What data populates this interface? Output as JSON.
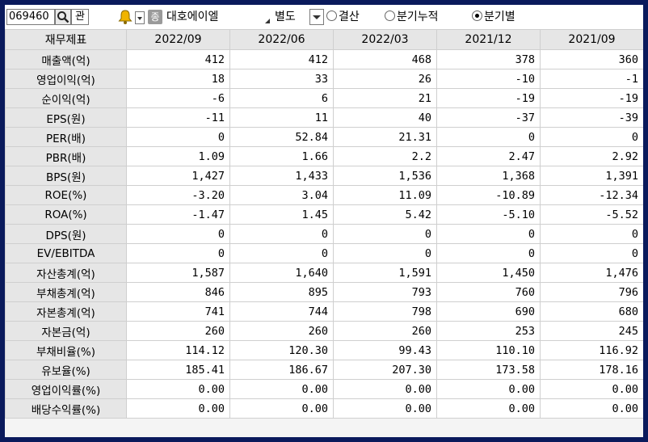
{
  "toolbar": {
    "code": "069460",
    "dropdown_label": "관",
    "name_icon": "종",
    "company_name": "대호에이엘",
    "select_value": "별도",
    "radios": [
      {
        "label": "결산",
        "selected": false
      },
      {
        "label": "분기누적",
        "selected": false
      },
      {
        "label": "분기별",
        "selected": true
      }
    ]
  },
  "table": {
    "corner_label": "재무제표",
    "columns": [
      "2022/09",
      "2022/06",
      "2022/03",
      "2021/12",
      "2021/09"
    ],
    "rows": [
      {
        "label": "매출액(억)",
        "values": [
          "412",
          "412",
          "468",
          "378",
          "360"
        ]
      },
      {
        "label": "영업이익(억)",
        "values": [
          "18",
          "33",
          "26",
          "-10",
          "-1"
        ]
      },
      {
        "label": "순이익(억)",
        "values": [
          "-6",
          "6",
          "21",
          "-19",
          "-19"
        ]
      },
      {
        "label": "EPS(원)",
        "values": [
          "-11",
          "11",
          "40",
          "-37",
          "-39"
        ]
      },
      {
        "label": "PER(배)",
        "values": [
          "0",
          "52.84",
          "21.31",
          "0",
          "0"
        ]
      },
      {
        "label": "PBR(배)",
        "values": [
          "1.09",
          "1.66",
          "2.2",
          "2.47",
          "2.92"
        ]
      },
      {
        "label": "BPS(원)",
        "values": [
          "1,427",
          "1,433",
          "1,536",
          "1,368",
          "1,391"
        ]
      },
      {
        "label": "ROE(%)",
        "values": [
          "-3.20",
          "3.04",
          "11.09",
          "-10.89",
          "-12.34"
        ]
      },
      {
        "label": "ROA(%)",
        "values": [
          "-1.47",
          "1.45",
          "5.42",
          "-5.10",
          "-5.52"
        ]
      },
      {
        "label": "DPS(원)",
        "values": [
          "0",
          "0",
          "0",
          "0",
          "0"
        ]
      },
      {
        "label": "EV/EBITDA",
        "values": [
          "0",
          "0",
          "0",
          "0",
          "0"
        ]
      },
      {
        "label": "자산총계(억)",
        "values": [
          "1,587",
          "1,640",
          "1,591",
          "1,450",
          "1,476"
        ]
      },
      {
        "label": "부채총계(억)",
        "values": [
          "846",
          "895",
          "793",
          "760",
          "796"
        ]
      },
      {
        "label": "자본총계(억)",
        "values": [
          "741",
          "744",
          "798",
          "690",
          "680"
        ]
      },
      {
        "label": "자본금(억)",
        "values": [
          "260",
          "260",
          "260",
          "253",
          "245"
        ]
      },
      {
        "label": "부채비율(%)",
        "values": [
          "114.12",
          "120.30",
          "99.43",
          "110.10",
          "116.92"
        ]
      },
      {
        "label": "유보율(%)",
        "values": [
          "185.41",
          "186.67",
          "207.30",
          "173.58",
          "178.16"
        ]
      },
      {
        "label": "영업이익률(%)",
        "values": [
          "0.00",
          "0.00",
          "0.00",
          "0.00",
          "0.00"
        ]
      },
      {
        "label": "배당수익률(%)",
        "values": [
          "0.00",
          "0.00",
          "0.00",
          "0.00",
          "0.00"
        ]
      }
    ]
  }
}
